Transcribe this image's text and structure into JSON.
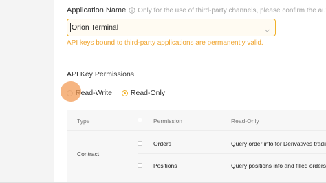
{
  "form": {
    "app_name": {
      "label": "Application Name",
      "info_icon": "info-circle-icon",
      "hint": "Only for the use of third-party channels, please confirm the authenticity of",
      "selected_value": "Orion Terminal",
      "chevron_icon": "chevron-down-icon",
      "warning": "API keys bound to third-party applications are permanently valid."
    },
    "permissions": {
      "title": "API Key Permissions",
      "options": [
        {
          "label": "Read-Write",
          "selected": false
        },
        {
          "label": "Read-Only",
          "selected": true
        }
      ]
    }
  },
  "table": {
    "headers": {
      "type": "Type",
      "permission": "Permission",
      "read_only": "Read-Only"
    },
    "type_value": "Contract",
    "rows": [
      {
        "permission": "Orders",
        "description": "Query order info for Derivatives trading or"
      },
      {
        "permission": "Positions",
        "description": "Query positions info and filled orders for"
      }
    ]
  },
  "colors": {
    "accent": "#f0b12a",
    "warning_text": "#f0a52f",
    "click_indicator": "#f39850"
  }
}
